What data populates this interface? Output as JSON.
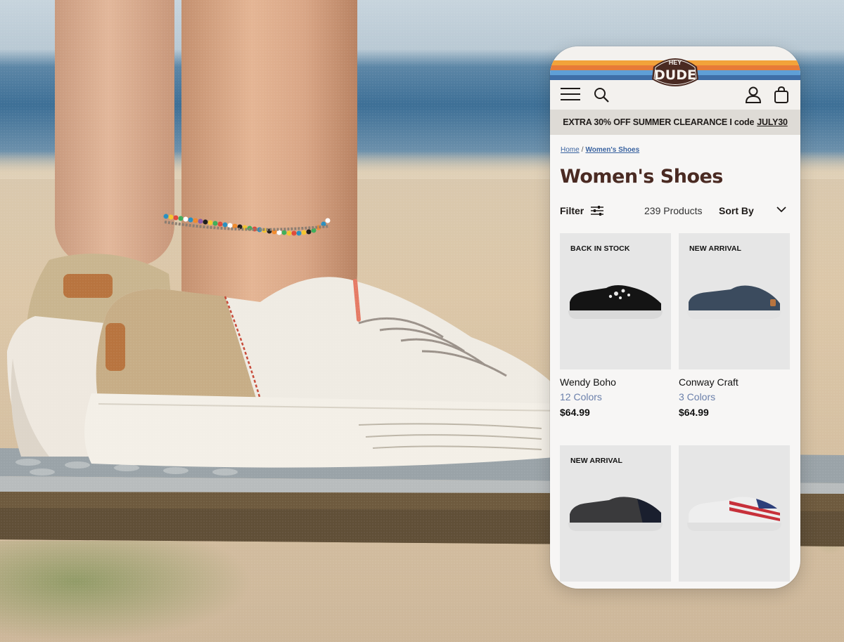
{
  "brand": {
    "logo_top": "HEY",
    "logo_bottom": "DUDE"
  },
  "header": {
    "menu_icon": "hamburger-menu-icon",
    "search_icon": "search-icon",
    "account_icon": "account-icon",
    "cart_icon": "shopping-bag-icon",
    "stripe_colors": [
      "#f2a33a",
      "#e77b38",
      "#5f9fd6",
      "#3f6fa8"
    ]
  },
  "promo": {
    "text": "EXTRA 30% OFF SUMMER CLEARANCE I code",
    "code": "JULY30"
  },
  "breadcrumb": {
    "home": "Home",
    "separator": "/",
    "current": "Women's Shoes"
  },
  "page": {
    "title": "Women's Shoes"
  },
  "toolbar": {
    "filter_label": "Filter",
    "filter_icon": "sliders-icon",
    "product_count": "239 Products",
    "sort_label": "Sort By",
    "sort_icon": "chevron-down-icon"
  },
  "products": [
    {
      "badge": "BACK IN STOCK",
      "name": "Wendy Boho",
      "colors": "12 Colors",
      "price": "$64.99"
    },
    {
      "badge": "NEW ARRIVAL",
      "name": "Conway Craft",
      "colors": "3 Colors",
      "price": "$64.99"
    },
    {
      "badge": "NEW ARRIVAL",
      "name": "",
      "colors": "",
      "price": ""
    },
    {
      "badge": "",
      "name": "",
      "colors": "",
      "price": ""
    }
  ],
  "colors": {
    "title": "#4a2a22",
    "link": "#3a63a0",
    "variant_text": "#6a7faa",
    "promo_bg": "#dedbd6"
  }
}
